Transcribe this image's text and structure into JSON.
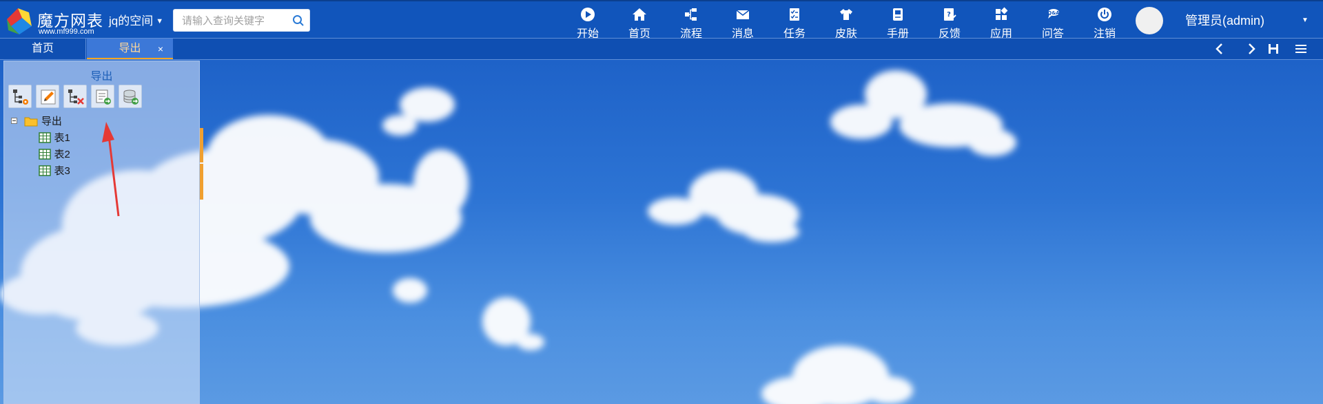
{
  "brand": {
    "name": "魔方网表",
    "url": "www.mf999.com"
  },
  "space": {
    "label": "jq的空间"
  },
  "search": {
    "placeholder": "请输入查询关键字"
  },
  "nav": {
    "items": [
      {
        "label": "开始",
        "icon": "play-icon"
      },
      {
        "label": "首页",
        "icon": "home-icon"
      },
      {
        "label": "流程",
        "icon": "workflow-icon"
      },
      {
        "label": "消息",
        "icon": "envelope-icon"
      },
      {
        "label": "任务",
        "icon": "task-icon"
      },
      {
        "label": "皮肤",
        "icon": "shirt-icon"
      },
      {
        "label": "手册",
        "icon": "manual-icon"
      },
      {
        "label": "反馈",
        "icon": "feedback-icon"
      },
      {
        "label": "应用",
        "icon": "apps-icon"
      },
      {
        "label": "问答",
        "icon": "qa-icon"
      },
      {
        "label": "注销",
        "icon": "power-icon"
      }
    ]
  },
  "user": {
    "name": "管理员(admin)"
  },
  "tabs": [
    {
      "label": "首页",
      "active": false
    },
    {
      "label": "导出",
      "active": true,
      "close": "×"
    }
  ],
  "panel": {
    "title": "导出",
    "toolbar": [
      {
        "name": "settings-tree",
        "icon": "tree-gear-icon"
      },
      {
        "name": "edit",
        "icon": "pencil-icon"
      },
      {
        "name": "delete-tree",
        "icon": "tree-delete-icon"
      },
      {
        "name": "export-form",
        "icon": "form-export-icon"
      },
      {
        "name": "export-database",
        "icon": "database-export-icon"
      }
    ],
    "tree": {
      "root": "导出",
      "children": [
        "表1",
        "表2",
        "表3"
      ]
    }
  },
  "colors": {
    "topbar": "#1155bb",
    "tab_active_accent": "#f5a623",
    "arrow": "#e53935",
    "splitter": "#f0a030"
  }
}
